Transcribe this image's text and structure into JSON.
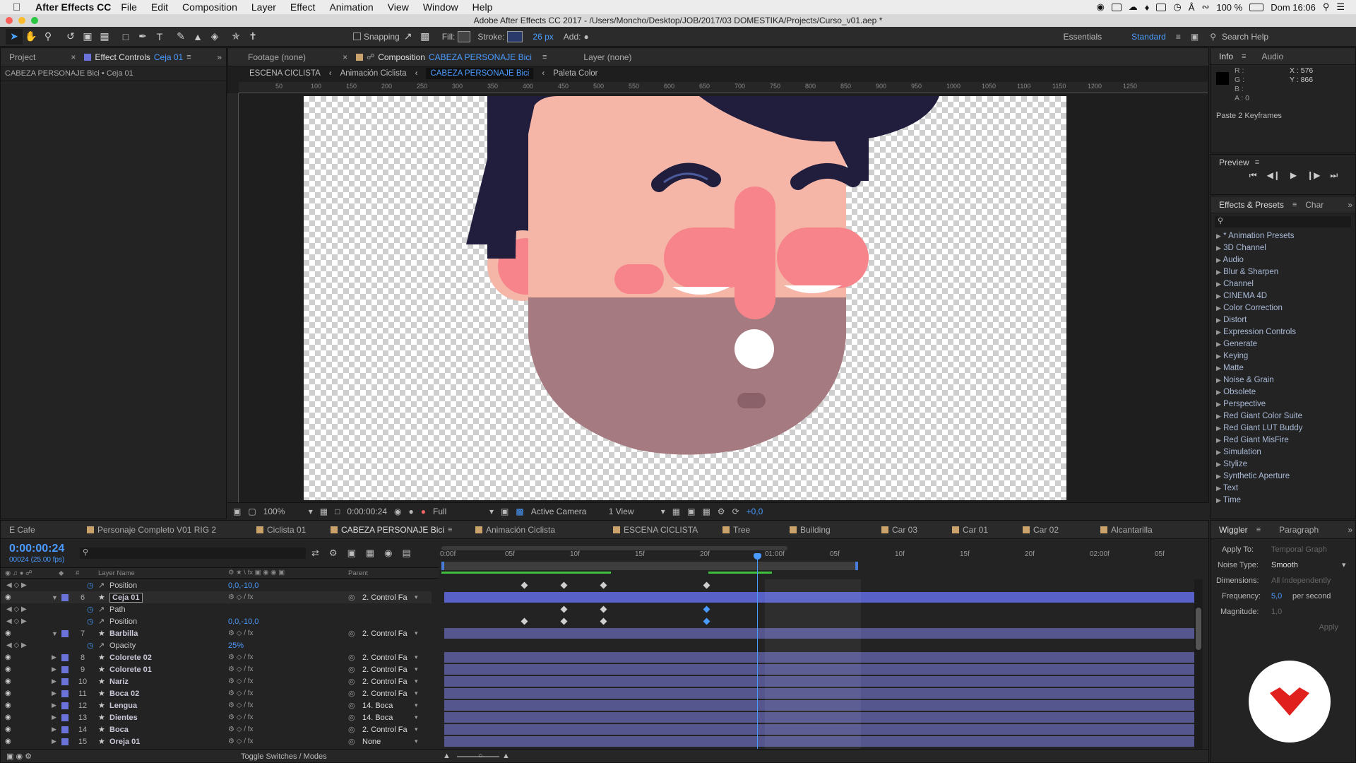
{
  "menubar": {
    "app": "After Effects CC",
    "items": [
      "File",
      "Edit",
      "Composition",
      "Layer",
      "Effect",
      "Animation",
      "View",
      "Window",
      "Help"
    ],
    "battery": "100 %",
    "clock": "Dom 16:06"
  },
  "window": {
    "title": "Adobe After Effects CC 2017 - /Users/Moncho/Desktop/JOB/2017/03 DOMESTIKA/Projects/Curso_v01.aep *"
  },
  "toolbar": {
    "snapping": "Snapping",
    "fill": "Fill:",
    "stroke": "Stroke:",
    "stroke_width": "26 px",
    "add": "Add:",
    "workspace1": "Essentials",
    "workspace2": "Standard",
    "search": "Search Help"
  },
  "left_panel": {
    "tab_project": "Project",
    "tab_effect": "Effect Controls",
    "tab_effect_layer": "Ceja 01",
    "subtitle": "CABEZA PERSONAJE Bici • Ceja 01"
  },
  "viewer": {
    "tab_footage": "Footage (none)",
    "tab_comp_prefix": "Composition",
    "tab_comp_name": "CABEZA PERSONAJE Bici",
    "tab_layer": "Layer (none)",
    "breadcrumbs": [
      "ESCENA CICLISTA",
      "Animación Ciclista",
      "CABEZA PERSONAJE Bici",
      "Paleta Color"
    ],
    "ruler_ticks": [
      "50",
      "100",
      "150",
      "200",
      "250",
      "300",
      "350",
      "400",
      "450",
      "500",
      "550",
      "600",
      "650",
      "700",
      "750",
      "800",
      "850",
      "900",
      "950",
      "1000",
      "1050",
      "1100",
      "1150",
      "1200",
      "1250"
    ],
    "zoom": "100%",
    "timecode": "0:00:00:24",
    "resolution": "Full",
    "camera": "Active Camera",
    "views": "1 View",
    "exposure": "+0,0"
  },
  "info": {
    "tab_info": "Info",
    "tab_audio": "Audio",
    "r": "R :",
    "g": "G :",
    "b": "B :",
    "a": "A : 0",
    "x": "X : 576",
    "y": "Y : 866",
    "message": "Paste 2 Keyframes"
  },
  "preview": {
    "title": "Preview"
  },
  "effects": {
    "tab": "Effects & Presets",
    "tab2": "Char",
    "items": [
      "* Animation Presets",
      "3D Channel",
      "Audio",
      "Blur & Sharpen",
      "Channel",
      "CINEMA 4D",
      "Color Correction",
      "Distort",
      "Expression Controls",
      "Generate",
      "Keying",
      "Matte",
      "Noise & Grain",
      "Obsolete",
      "Perspective",
      "Red Giant Color Suite",
      "Red Giant LUT Buddy",
      "Red Giant MisFire",
      "Simulation",
      "Stylize",
      "Synthetic Aperture",
      "Text",
      "Time"
    ]
  },
  "timeline_tabs": [
    "E Cafe",
    "Personaje Completo V01 RIG 2",
    "Ciclista 01",
    "CABEZA PERSONAJE Bici",
    "Animación Ciclista",
    "ESCENA CICLISTA",
    "Tree",
    "Building",
    "Car 03",
    "Car 01",
    "Car 02",
    "Alcantarilla"
  ],
  "timeline": {
    "timecode": "0:00:00:24",
    "frames": "00024 (25.00 fps)",
    "col_layer_name": "Layer Name",
    "col_parent": "Parent",
    "toggle": "Toggle Switches / Modes",
    "ticks": [
      "0:00f",
      "05f",
      "10f",
      "15f",
      "20f",
      "01:00f",
      "05f",
      "10f",
      "15f",
      "20f",
      "02:00f",
      "05f"
    ],
    "rows": [
      {
        "type": "prop",
        "name": "Position",
        "value": "0,0,-10,0"
      },
      {
        "type": "layer",
        "num": "6",
        "name": "Ceja 01",
        "parent": "2. Control Fa",
        "selected": true
      },
      {
        "type": "prop",
        "name": "Path",
        "value": ""
      },
      {
        "type": "prop",
        "name": "Position",
        "value": "0,0,-10,0"
      },
      {
        "type": "layer",
        "num": "7",
        "name": "Barbilla",
        "parent": "2. Control Fa"
      },
      {
        "type": "prop",
        "name": "Opacity",
        "value": "25%"
      },
      {
        "type": "layer",
        "num": "8",
        "name": "Colorete 02",
        "parent": "2. Control Fa"
      },
      {
        "type": "layer",
        "num": "9",
        "name": "Colorete 01",
        "parent": "2. Control Fa"
      },
      {
        "type": "layer",
        "num": "10",
        "name": "Nariz",
        "parent": "2. Control Fa"
      },
      {
        "type": "layer",
        "num": "11",
        "name": "Boca 02",
        "parent": "2. Control Fa"
      },
      {
        "type": "layer",
        "num": "12",
        "name": "Lengua",
        "parent": "14. Boca"
      },
      {
        "type": "layer",
        "num": "13",
        "name": "Dientes",
        "parent": "14. Boca"
      },
      {
        "type": "layer",
        "num": "14",
        "name": "Boca",
        "parent": "2. Control Fa"
      },
      {
        "type": "layer",
        "num": "15",
        "name": "Oreja 01",
        "parent": "None"
      }
    ]
  },
  "wiggler": {
    "tab": "Wiggler",
    "tab2": "Paragraph",
    "apply_to_label": "Apply To:",
    "apply_to": "Temporal Graph",
    "noise_label": "Noise Type:",
    "noise": "Smooth",
    "dim_label": "Dimensions:",
    "dim": "All Independently",
    "freq_label": "Frequency:",
    "freq": "5,0",
    "freq_unit": "per second",
    "mag_label": "Magnitude:",
    "mag": "1,0",
    "apply": "Apply"
  },
  "colors": {
    "accent": "#4a9bff",
    "layer_label": "#6b72d8",
    "hair": "#211d3d",
    "skin": "#f5b6a8",
    "cheek": "#f6848a",
    "beard": "#a57b81",
    "logo": "#e0201c"
  }
}
